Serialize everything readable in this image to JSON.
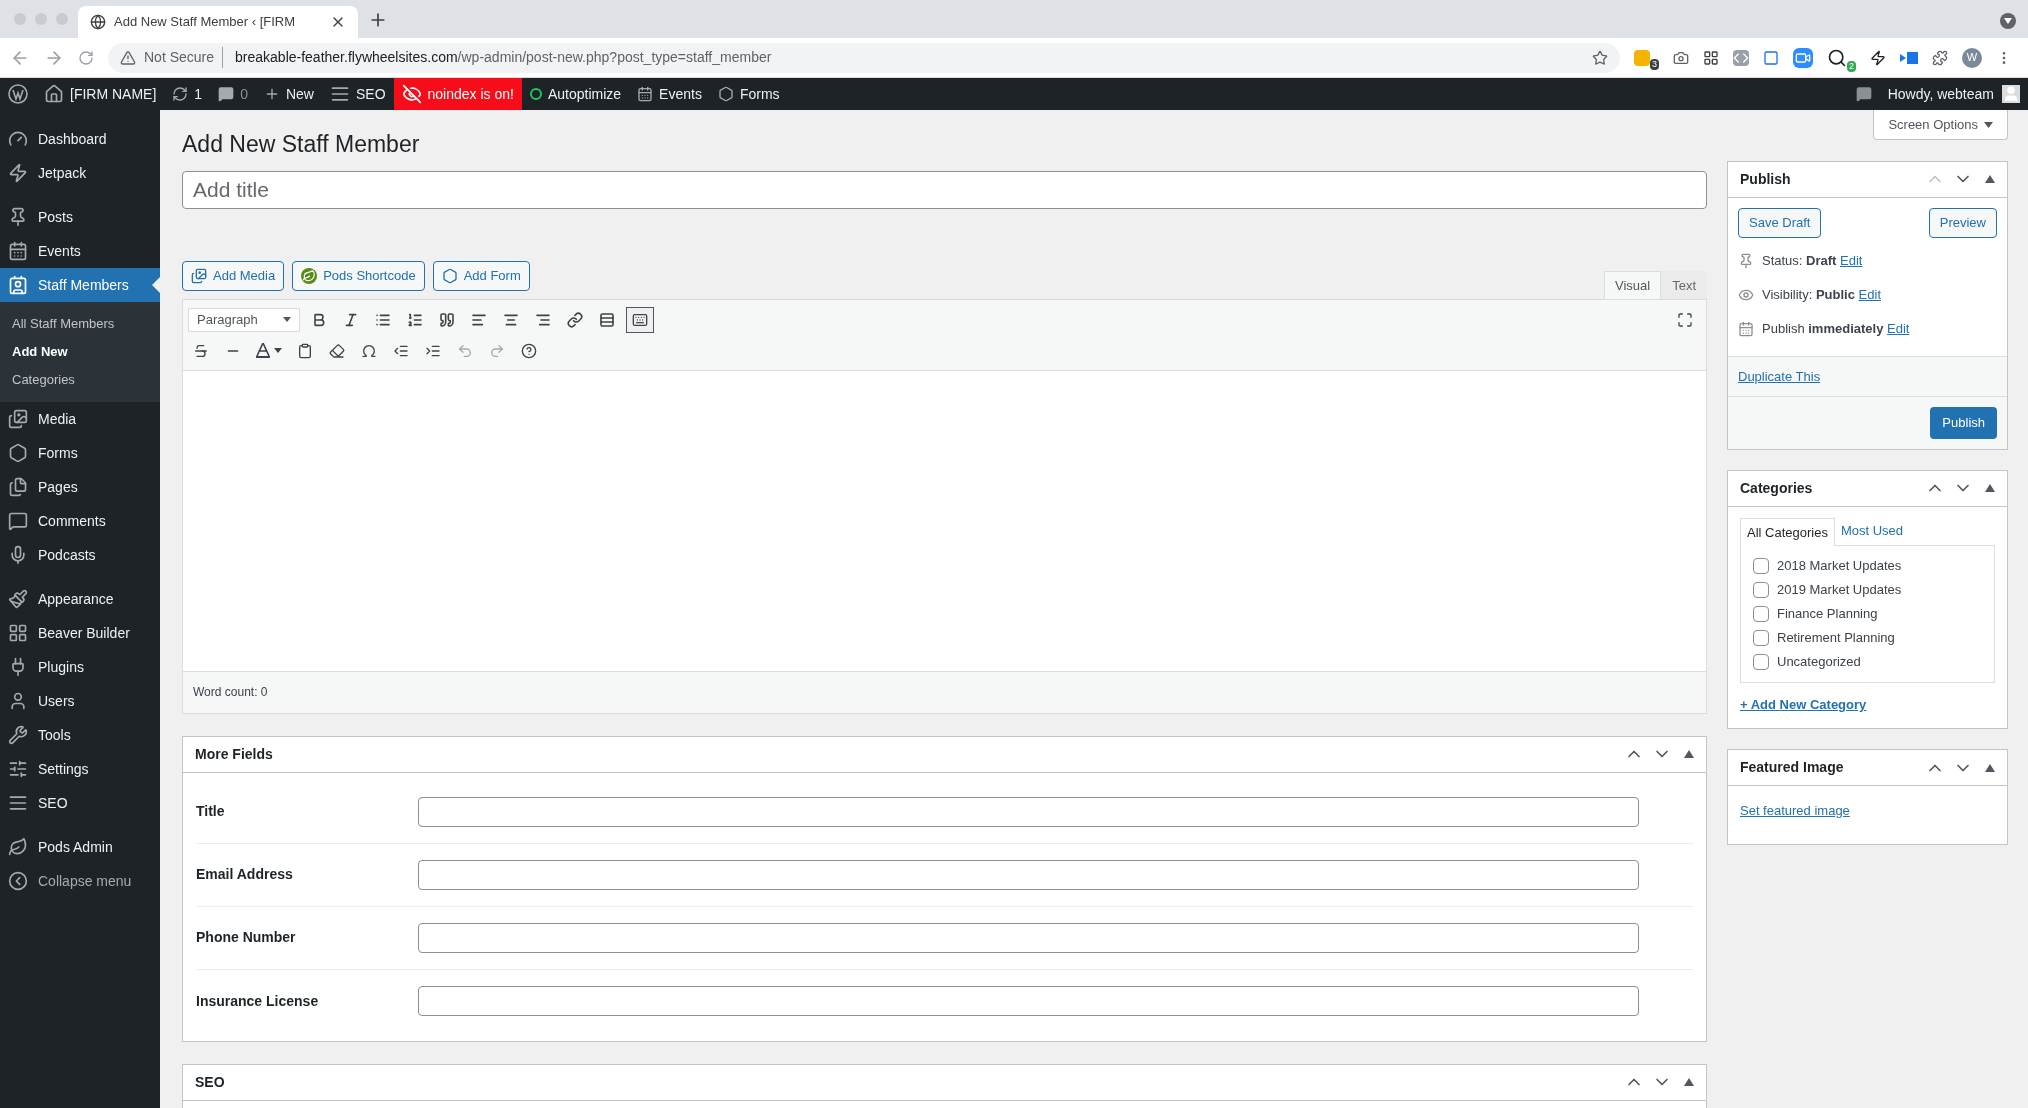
{
  "browser": {
    "tab_title": "Add New Staff Member ‹ [FIRM",
    "security": "Not Secure",
    "url_host": "breakable-feather.flywheelsites.com",
    "url_path": "/wp-admin/post-new.php?post_type=staff_member",
    "extension_badges": [
      "3",
      "2"
    ],
    "profile_letter": "W"
  },
  "admin_bar": {
    "items": [
      {
        "kind": "logo"
      },
      {
        "kind": "site",
        "label": "[FIRM NAME]"
      },
      {
        "kind": "updates",
        "label": "1"
      },
      {
        "kind": "comments",
        "label": "0"
      },
      {
        "kind": "new",
        "label": "New"
      },
      {
        "kind": "seo",
        "label": "SEO"
      },
      {
        "kind": "noindex",
        "label": "noindex is on!"
      },
      {
        "kind": "status",
        "label": "Autoptimize"
      },
      {
        "kind": "events",
        "label": "Events"
      },
      {
        "kind": "forms",
        "label": "Forms"
      }
    ],
    "greeting": "Howdy, webteam"
  },
  "sidebar": {
    "groups": [
      [
        {
          "label": "Dashboard",
          "selected": false
        },
        {
          "label": "Jetpack",
          "selected": false
        }
      ],
      [
        {
          "label": "Posts",
          "selected": false
        },
        {
          "label": "Events",
          "selected": false
        },
        {
          "label": "Staff Members",
          "selected": true,
          "children": [
            {
              "label": "All Staff Members",
              "selected": false
            },
            {
              "label": "Add New",
              "selected": true
            },
            {
              "label": "Categories",
              "selected": false
            }
          ]
        },
        {
          "label": "Media",
          "selected": false
        },
        {
          "label": "Forms",
          "selected": false
        },
        {
          "label": "Pages",
          "selected": false
        },
        {
          "label": "Comments",
          "selected": false
        },
        {
          "label": "Podcasts",
          "selected": false
        }
      ],
      [
        {
          "label": "Appearance",
          "selected": false
        },
        {
          "label": "Beaver Builder",
          "selected": false
        },
        {
          "label": "Plugins",
          "selected": false
        },
        {
          "label": "Users",
          "selected": false
        },
        {
          "label": "Tools",
          "selected": false
        },
        {
          "label": "Settings",
          "selected": false
        },
        {
          "label": "SEO",
          "selected": false
        }
      ],
      [
        {
          "label": "Pods Admin",
          "selected": false
        },
        {
          "label": "Collapse menu",
          "selected": false
        }
      ]
    ]
  },
  "screen_options": "Screen Options",
  "page_title": "Add New Staff Member",
  "title_field": {
    "placeholder": "Add title"
  },
  "media_buttons": [
    "Add Media",
    "Pods Shortcode",
    "Add Form"
  ],
  "editor": {
    "tabs": [
      {
        "label": "Visual",
        "selected": true
      },
      {
        "label": "Text",
        "selected": false
      }
    ],
    "format": "Paragraph",
    "toolbar_toggle_on": true,
    "word_count": "Word count: 0"
  },
  "more_fields": {
    "title": "More Fields",
    "fields": [
      {
        "label": "Title"
      },
      {
        "label": "Email Address"
      },
      {
        "label": "Phone Number"
      },
      {
        "label": "Insurance License"
      }
    ]
  },
  "seo_box": {
    "title": "SEO"
  },
  "publish": {
    "title": "Publish",
    "save_draft": "Save Draft",
    "preview": "Preview",
    "rows": [
      {
        "text": "Status: **Draft**",
        "link": "Edit"
      },
      {
        "text": "Visibility: **Public**",
        "link": "Edit"
      },
      {
        "text": "Publish **immediately**",
        "link": "Edit"
      }
    ],
    "duplicate": "Duplicate This",
    "publish_button": "Publish"
  },
  "categories": {
    "title": "Categories",
    "tabs": [
      {
        "label": "All Categories",
        "selected": true
      },
      {
        "label": "Most Used",
        "selected": false
      }
    ],
    "items": [
      {
        "label": "2018 Market Updates",
        "checked": false
      },
      {
        "label": "2019 Market Updates",
        "checked": false
      },
      {
        "label": "Finance Planning",
        "checked": false
      },
      {
        "label": "Retirement Planning",
        "checked": false
      },
      {
        "label": "Uncategorized",
        "checked": false
      }
    ],
    "add_new": "+ Add New Category"
  },
  "featured_image": {
    "title": "Featured Image",
    "link": "Set featured image"
  }
}
